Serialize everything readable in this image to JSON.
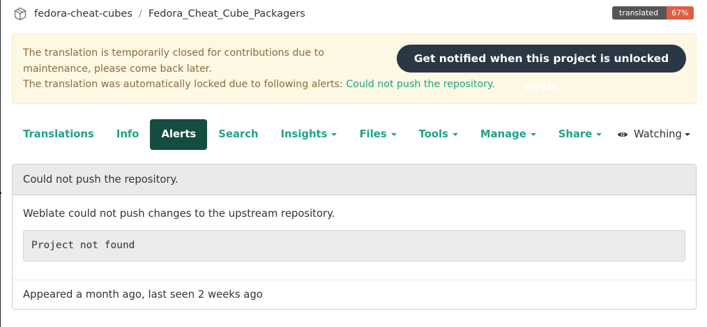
{
  "breadcrumb": {
    "project": "fedora-cheat-cubes",
    "separator": "/",
    "component": "Fedora_Cheat_Cube_Packagers"
  },
  "badge": {
    "label": "translated",
    "value": "67%"
  },
  "alert": {
    "line1": "The translation is temporarily closed for contributions due to maintenance, please come back later.",
    "line2_prefix": "The translation was automatically locked due to following alerts:",
    "line2_link": "Could not push the repository.",
    "notify_button": "Get notified when this project is unlocked again"
  },
  "tabs": [
    {
      "label": "Translations"
    },
    {
      "label": "Info"
    },
    {
      "label": "Alerts"
    },
    {
      "label": "Search"
    },
    {
      "label": "Insights"
    },
    {
      "label": "Files"
    },
    {
      "label": "Tools"
    },
    {
      "label": "Manage"
    },
    {
      "label": "Share"
    }
  ],
  "watch": {
    "label": "Watching"
  },
  "panel": {
    "heading": "Could not push the repository.",
    "description": "Weblate could not push changes to the upstream repository.",
    "error_output": "Project not found",
    "footer": "Appeared a month ago, last seen 2 weeks ago"
  },
  "colors": {
    "link": "#1fa385",
    "active_tab": "#144d3f",
    "notify_button": "#2a3744",
    "alert_bg": "#fcf8e3",
    "alert_text": "#8a6d3b",
    "badge_value": "#e05d44"
  }
}
